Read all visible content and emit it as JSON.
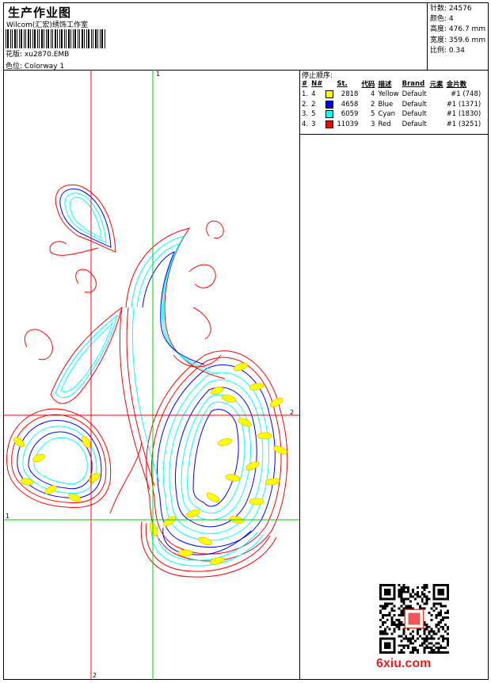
{
  "header": {
    "title": "生产作业图",
    "studio": "Wilcom(汇宏)绣饰工作室",
    "design_label": "花版:",
    "design_value": "xu2870.EMB",
    "colorway_label": "色位:",
    "colorway_value": "Colorway 1"
  },
  "meta": [
    {
      "label": "针数:",
      "value": "24576"
    },
    {
      "label": "颜色:",
      "value": "4"
    },
    {
      "label": "高度:",
      "value": "476.7 mm"
    },
    {
      "label": "宽度:",
      "value": "359.6 mm"
    },
    {
      "label": "比例:",
      "value": "0.34"
    }
  ],
  "stop_sequence": {
    "label": "停止顺序:",
    "headers": [
      "#",
      "N#",
      "",
      "St.",
      "代码",
      "描述",
      "Brand",
      "元素",
      "金片数"
    ],
    "rows": [
      {
        "idx": "1.",
        "n": "4",
        "color": "#ffff00",
        "st": "2818",
        "code": "4",
        "desc": "Yellow",
        "brand": "Default",
        "elem": "",
        "seq": "#1 (748)"
      },
      {
        "idx": "2.",
        "n": "2",
        "color": "#0000ff",
        "st": "4658",
        "code": "2",
        "desc": "Blue",
        "brand": "Default",
        "elem": "",
        "seq": "#1 (1371)"
      },
      {
        "idx": "3.",
        "n": "5",
        "color": "#00ffff",
        "st": "6059",
        "code": "5",
        "desc": "Cyan",
        "brand": "Default",
        "elem": "",
        "seq": "#1 (1830)"
      },
      {
        "idx": "4.",
        "n": "3",
        "color": "#ff0000",
        "st": "11039",
        "code": "3",
        "desc": "Red",
        "brand": "Default",
        "elem": "",
        "seq": "#1 (3251)"
      }
    ]
  },
  "guides": {
    "green_top": "1",
    "red_right": "2",
    "green_left": "1",
    "red_bottom": "2"
  },
  "watermark": "6xiu.com"
}
